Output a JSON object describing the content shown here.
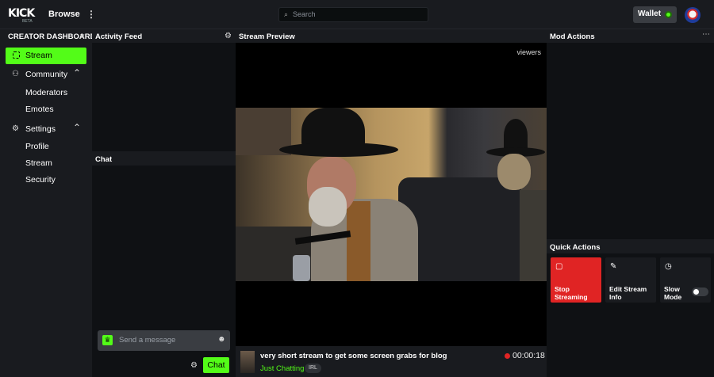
{
  "header": {
    "logo_text": "KICK",
    "logo_badge": "BETA",
    "browse_label": "Browse",
    "more_icon": "ellipsis-vertical-icon",
    "search_placeholder": "Search",
    "wallet_label": "Wallet"
  },
  "sidebar": {
    "title": "CREATOR DASHBOARD",
    "close_glyph": "✕",
    "active_item": "Stream",
    "groups": [
      {
        "label": "Community",
        "icon": "users-icon",
        "items": [
          "Moderators",
          "Emotes"
        ]
      },
      {
        "label": "Settings",
        "icon": "settings-icon",
        "items": [
          "Profile",
          "Stream",
          "Security"
        ]
      }
    ]
  },
  "activity_feed": {
    "title": "Activity Feed"
  },
  "chat": {
    "title": "Chat",
    "input_placeholder": "Send a message",
    "send_label": "Chat"
  },
  "stream_preview": {
    "title": "Stream Preview",
    "viewers_label": "viewers",
    "stream_title": "very short stream to get some screen grabs for blog",
    "category": "Just Chatting",
    "tag": "IRL",
    "timer": "00:00:18"
  },
  "mod_actions": {
    "title": "Mod Actions"
  },
  "quick_actions": {
    "title": "Quick Actions",
    "cards": [
      {
        "label": "Stop Streaming",
        "icon": "stop-icon",
        "color": "#e02424"
      },
      {
        "label": "Edit Stream Info",
        "icon": "pencil-icon",
        "color": "#191b1f"
      },
      {
        "label": "Slow Mode",
        "icon": "clock-icon",
        "color": "#191b1f",
        "toggle_on": false
      }
    ]
  },
  "colors": {
    "accent": "#53fc18",
    "danger": "#e02424",
    "panel": "#191b1f",
    "background": "#0b0e0f"
  }
}
